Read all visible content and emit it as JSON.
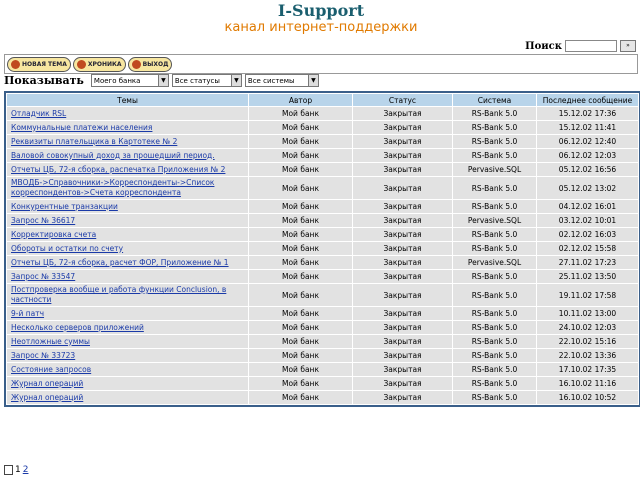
{
  "header": {
    "title": "I-Support",
    "subtitle": "канал интернет-поддержки"
  },
  "search": {
    "label": "Поиск",
    "button": "»"
  },
  "toolbar": {
    "new_topic": "НОВАЯ ТЕМА",
    "archive": "ХРОНИКА",
    "exit": "ВЫХОД"
  },
  "filters": {
    "label": "Показывать",
    "bank": "Моего банка",
    "status": "Все статусы",
    "system": "Все системы"
  },
  "table": {
    "headers": [
      "Темы",
      "Автор",
      "Статус",
      "Система",
      "Последнее сообщение"
    ],
    "rows": [
      {
        "topic": "Отладчик RSL",
        "author": "Мой банк",
        "status": "Закрытая",
        "system": "RS-Bank 5.0",
        "last": "15.12.02 17:36"
      },
      {
        "topic": "Коммунальные платежи населения",
        "author": "Мой банк",
        "status": "Закрытая",
        "system": "RS-Bank 5.0",
        "last": "15.12.02 11:41"
      },
      {
        "topic": "Реквизиты плательщика в Картотеке № 2",
        "author": "Мой банк",
        "status": "Закрытая",
        "system": "RS-Bank 5.0",
        "last": "06.12.02 12:40"
      },
      {
        "topic": "Валовой совокупный доход за прошедший период.",
        "author": "Мой банк",
        "status": "Закрытая",
        "system": "RS-Bank 5.0",
        "last": "06.12.02 12:03"
      },
      {
        "topic": "Отчеты ЦБ, 72-я сборка, распечатка Приложения № 2",
        "author": "Мой банк",
        "status": "Закрытая",
        "system": "Pervasive.SQL",
        "last": "05.12.02 16:56"
      },
      {
        "topic": "МВОДБ->Справочники->Корреспонденты->Список корреспондентов->Счета корреспондента",
        "author": "Мой банк",
        "status": "Закрытая",
        "system": "RS-Bank 5.0",
        "last": "05.12.02 13:02"
      },
      {
        "topic": "Конкурентные транзакции",
        "author": "Мой банк",
        "status": "Закрытая",
        "system": "RS-Bank 5.0",
        "last": "04.12.02 16:01"
      },
      {
        "topic": "Запрос № 36617",
        "author": "Мой банк",
        "status": "Закрытая",
        "system": "Pervasive.SQL",
        "last": "03.12.02 10:01"
      },
      {
        "topic": "Корректировка счета",
        "author": "Мой банк",
        "status": "Закрытая",
        "system": "RS-Bank 5.0",
        "last": "02.12.02 16:03"
      },
      {
        "topic": "Обороты и остатки по счету",
        "author": "Мой банк",
        "status": "Закрытая",
        "system": "RS-Bank 5.0",
        "last": "02.12.02 15:58"
      },
      {
        "topic": "Отчеты ЦБ, 72-я сборка, расчет ФОР, Приложение № 1",
        "author": "Мой банк",
        "status": "Закрытая",
        "system": "Pervasive.SQL",
        "last": "27.11.02 17:23"
      },
      {
        "topic": "Запрос № 33547",
        "author": "Мой банк",
        "status": "Закрытая",
        "system": "RS-Bank 5.0",
        "last": "25.11.02 13:50"
      },
      {
        "topic": "Постпроверка вообще и работа функции Conclusion, в частности",
        "author": "Мой банк",
        "status": "Закрытая",
        "system": "RS-Bank 5.0",
        "last": "19.11.02 17:58"
      },
      {
        "topic": "9-й патч",
        "author": "Мой банк",
        "status": "Закрытая",
        "system": "RS-Bank 5.0",
        "last": "10.11.02 13:00"
      },
      {
        "topic": "Несколько серверов приложений",
        "author": "Мой банк",
        "status": "Закрытая",
        "system": "RS-Bank 5.0",
        "last": "24.10.02 12:03"
      },
      {
        "topic": "Неотложные суммы",
        "author": "Мой банк",
        "status": "Закрытая",
        "system": "RS-Bank 5.0",
        "last": "22.10.02 15:16"
      },
      {
        "topic": "Запрос № 33723",
        "author": "Мой банк",
        "status": "Закрытая",
        "system": "RS-Bank 5.0",
        "last": "22.10.02 13:36"
      },
      {
        "topic": "Состояние запросов",
        "author": "Мой банк",
        "status": "Закрытая",
        "system": "RS-Bank 5.0",
        "last": "17.10.02 17:35"
      },
      {
        "topic": "Журнал операций",
        "author": "Мой банк",
        "status": "Закрытая",
        "system": "RS-Bank 5.0",
        "last": "16.10.02 11:16"
      },
      {
        "topic": "Журнал операций",
        "author": "Мой банк",
        "status": "Закрытая",
        "system": "RS-Bank 5.0",
        "last": "16.10.02 10:52"
      }
    ]
  },
  "pager": {
    "current": "1",
    "next": "2"
  }
}
